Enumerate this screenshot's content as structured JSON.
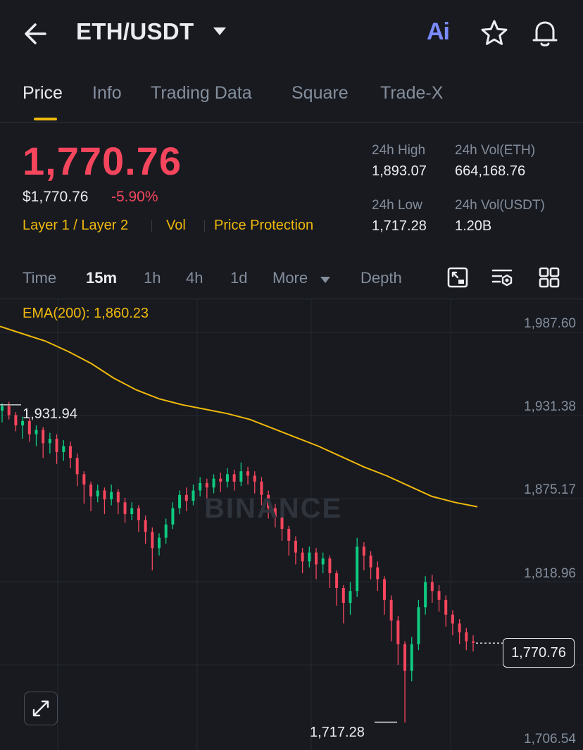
{
  "header": {
    "pair": "ETH/USDT",
    "ai_label": "Ai",
    "icons": [
      "back-arrow-icon",
      "chevron-down-icon",
      "star-icon",
      "bell-icon"
    ]
  },
  "tabs": [
    "Price",
    "Info",
    "Trading Data",
    "Square",
    "Trade-X"
  ],
  "active_tab": "Price",
  "price": {
    "last": "1,770.76",
    "usd": "$1,770.76",
    "change": "-5.90%",
    "tags": [
      "Layer 1 / Layer 2",
      "Vol",
      "Price Protection"
    ]
  },
  "stats": {
    "high_label": "24h High",
    "high_value": "1,893.07",
    "vol_eth_label": "24h Vol(ETH)",
    "vol_eth_value": "664,168.76",
    "low_label": "24h Low",
    "low_value": "1,717.28",
    "vol_usdt_label": "24h Vol(USDT)",
    "vol_usdt_value": "1.20B"
  },
  "intervals": {
    "items": [
      "Time",
      "15m",
      "1h",
      "4h",
      "1d",
      "More"
    ],
    "active": "15m",
    "depth": "Depth"
  },
  "chart": {
    "ema_label": "EMA(200): 1,860.23",
    "y_labels": [
      "1,987.60",
      "1,931.38",
      "1,875.17",
      "1,818.96",
      "1,706.54"
    ],
    "current_price": "1,770.76",
    "period_high": "1,931.94",
    "period_low": "1,717.28",
    "watermark": "BINANCE"
  },
  "colors": {
    "up": "#0ecb81",
    "down": "#f6465d",
    "ema": "#f0b90b",
    "accent": "#f0b90b",
    "bg": "#181a20"
  },
  "chart_data": {
    "type": "candlestick",
    "y_range": [
      1700,
      1995
    ],
    "ema200": [
      1985,
      1980,
      1975,
      1968,
      1960,
      1950,
      1942,
      1936,
      1932,
      1929,
      1926,
      1922,
      1916,
      1910,
      1904,
      1897,
      1890,
      1884,
      1877,
      1870,
      1866,
      1863
    ],
    "candles": [
      [
        1928,
        1931,
        1920,
        1933
      ],
      [
        1931,
        1925,
        1922,
        1934
      ],
      [
        1925,
        1918,
        1914,
        1927
      ],
      [
        1918,
        1921,
        1909,
        1924
      ],
      [
        1921,
        1912,
        1907,
        1923
      ],
      [
        1912,
        1915,
        1904,
        1918
      ],
      [
        1915,
        1906,
        1896,
        1917
      ],
      [
        1906,
        1909,
        1899,
        1913
      ],
      [
        1909,
        1900,
        1892,
        1912
      ],
      [
        1900,
        1904,
        1894,
        1908
      ],
      [
        1904,
        1896,
        1889,
        1907
      ],
      [
        1896,
        1885,
        1877,
        1899
      ],
      [
        1885,
        1878,
        1865,
        1887
      ],
      [
        1878,
        1870,
        1860,
        1880
      ],
      [
        1870,
        1874,
        1866,
        1878
      ],
      [
        1874,
        1868,
        1858,
        1876
      ],
      [
        1868,
        1873,
        1864,
        1878
      ],
      [
        1873,
        1866,
        1858,
        1875
      ],
      [
        1866,
        1858,
        1852,
        1869
      ],
      [
        1858,
        1862,
        1854,
        1866
      ],
      [
        1862,
        1854,
        1846,
        1864
      ],
      [
        1854,
        1846,
        1838,
        1857
      ],
      [
        1846,
        1835,
        1820,
        1849
      ],
      [
        1835,
        1842,
        1830,
        1845
      ],
      [
        1842,
        1851,
        1838,
        1855
      ],
      [
        1851,
        1862,
        1848,
        1866
      ],
      [
        1862,
        1871,
        1858,
        1874
      ],
      [
        1871,
        1867,
        1860,
        1876
      ],
      [
        1867,
        1874,
        1864,
        1878
      ],
      [
        1874,
        1879,
        1870,
        1883
      ],
      [
        1879,
        1876,
        1868,
        1882
      ],
      [
        1876,
        1882,
        1872,
        1885
      ],
      [
        1882,
        1880,
        1873,
        1886
      ],
      [
        1880,
        1885,
        1876,
        1889
      ],
      [
        1885,
        1880,
        1874,
        1888
      ],
      [
        1880,
        1887,
        1877,
        1893
      ],
      [
        1887,
        1884,
        1878,
        1890
      ],
      [
        1884,
        1880,
        1872,
        1887
      ],
      [
        1880,
        1871,
        1864,
        1883
      ],
      [
        1871,
        1862,
        1855,
        1874
      ],
      [
        1862,
        1856,
        1849,
        1865
      ],
      [
        1856,
        1848,
        1840,
        1859
      ],
      [
        1848,
        1840,
        1830,
        1850
      ],
      [
        1840,
        1832,
        1824,
        1843
      ],
      [
        1832,
        1826,
        1818,
        1835
      ],
      [
        1826,
        1832,
        1822,
        1836
      ],
      [
        1832,
        1824,
        1814,
        1835
      ],
      [
        1824,
        1828,
        1818,
        1832
      ],
      [
        1828,
        1818,
        1808,
        1830
      ],
      [
        1818,
        1808,
        1796,
        1820
      ],
      [
        1808,
        1798,
        1784,
        1810
      ],
      [
        1798,
        1806,
        1790,
        1812
      ],
      [
        1806,
        1836,
        1802,
        1842
      ],
      [
        1836,
        1830,
        1820,
        1839
      ],
      [
        1830,
        1822,
        1814,
        1833
      ],
      [
        1822,
        1814,
        1806,
        1826
      ],
      [
        1814,
        1800,
        1790,
        1816
      ],
      [
        1800,
        1786,
        1772,
        1803
      ],
      [
        1786,
        1770,
        1756,
        1789
      ],
      [
        1770,
        1752,
        1717,
        1772
      ],
      [
        1752,
        1770,
        1745,
        1775
      ],
      [
        1770,
        1795,
        1766,
        1800
      ],
      [
        1795,
        1812,
        1790,
        1816
      ],
      [
        1812,
        1806,
        1798,
        1817
      ],
      [
        1806,
        1800,
        1792,
        1810
      ],
      [
        1800,
        1790,
        1782,
        1803
      ],
      [
        1790,
        1784,
        1776,
        1793
      ],
      [
        1784,
        1778,
        1770,
        1787
      ],
      [
        1778,
        1772,
        1766,
        1781
      ],
      [
        1772,
        1771,
        1765,
        1776
      ]
    ]
  }
}
